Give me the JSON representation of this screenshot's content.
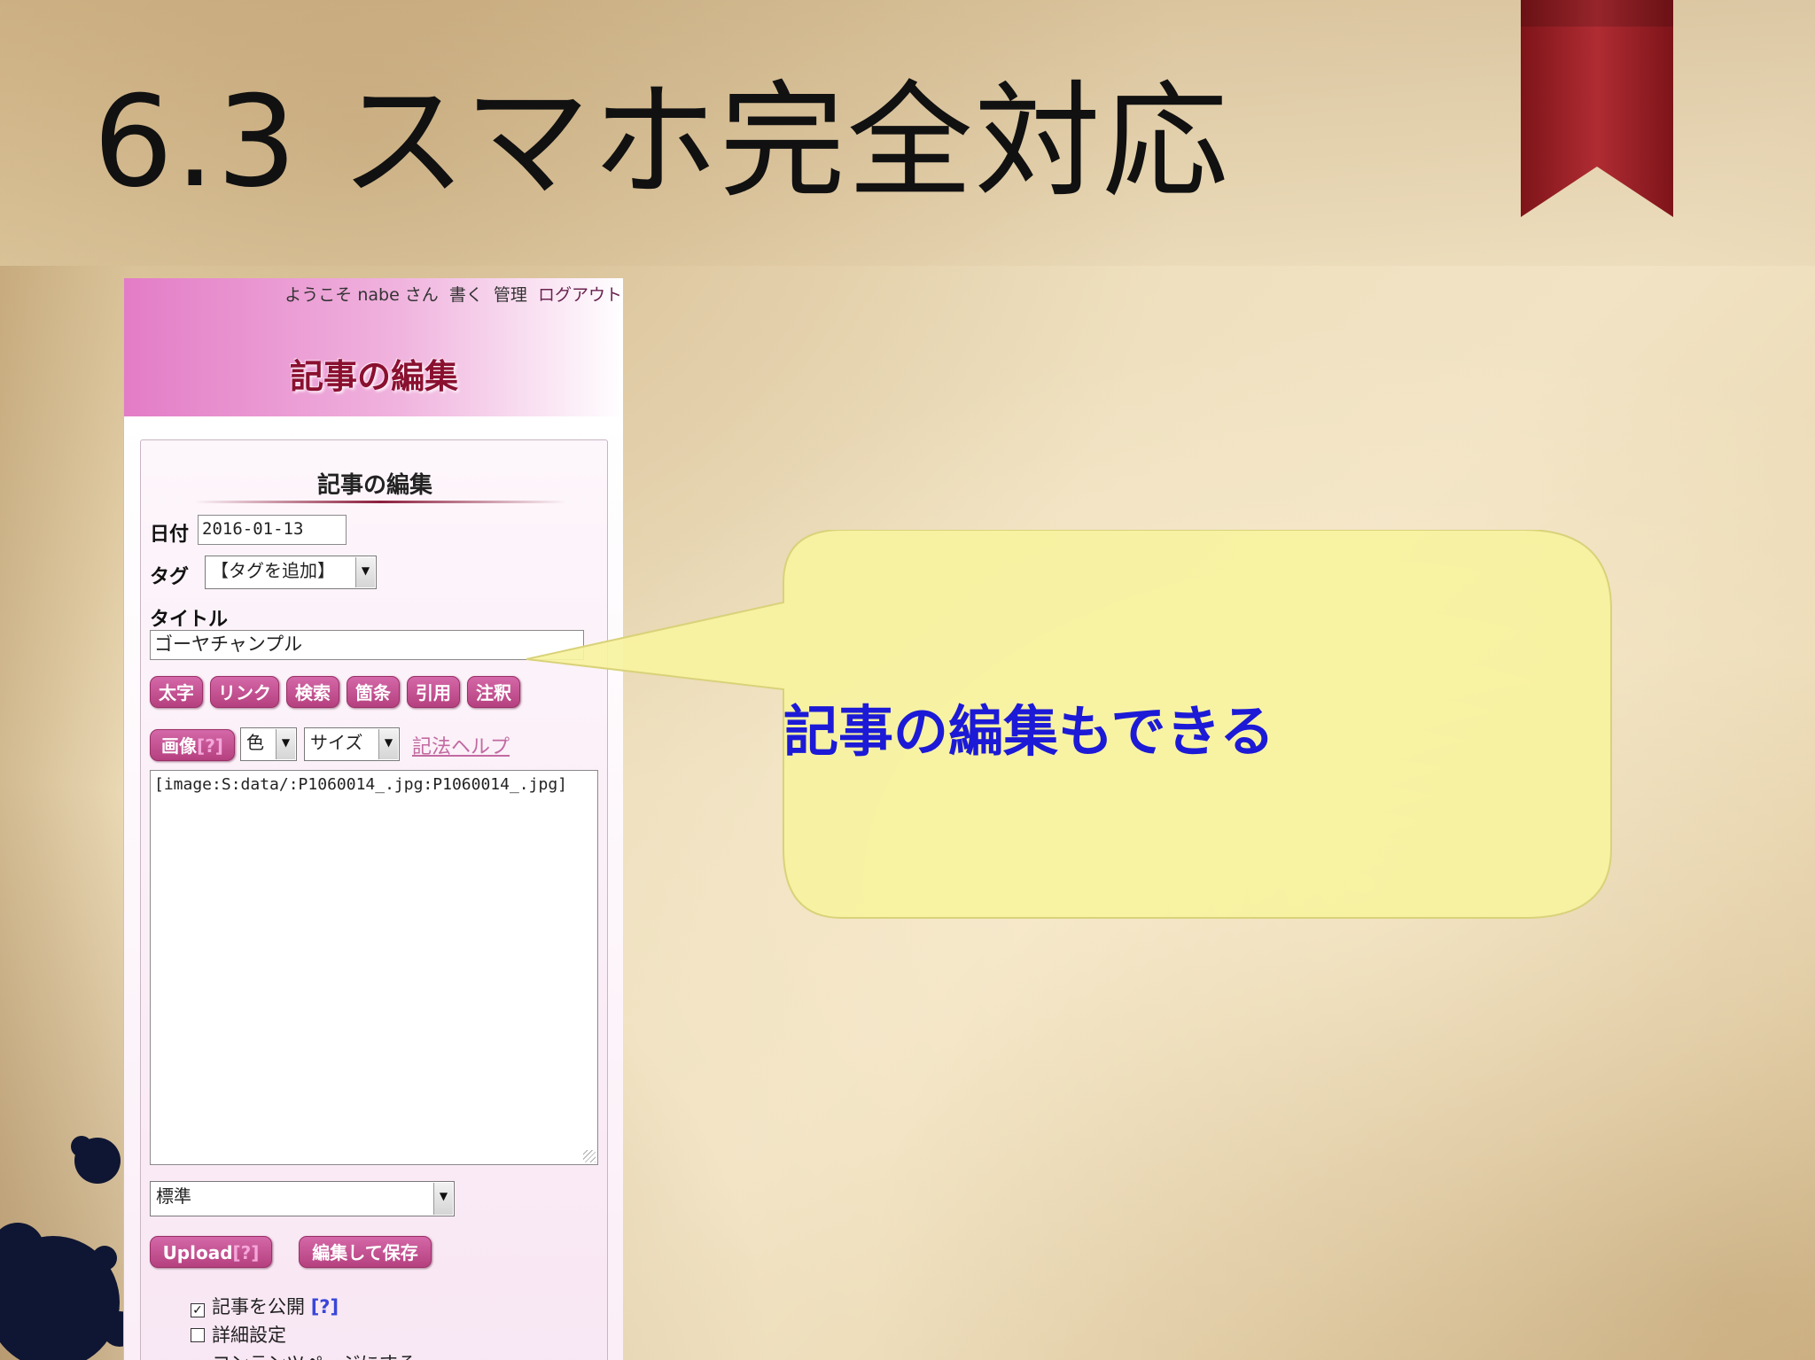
{
  "slide": {
    "title": "6.3 スマホ完全対応"
  },
  "phone": {
    "user_bar": {
      "welcome": "ようこそ nabe さん",
      "write": "書く",
      "admin": "管理",
      "logout": "ログアウト"
    },
    "blog_title": "記事の編集",
    "panel": {
      "title": "記事の編集",
      "date_label": "日付",
      "date_value": "2016-01-13",
      "tag_label": "タグ",
      "tag_selected": "【タグを追加】",
      "title_label": "タイトル",
      "title_value": "ゴーヤチャンプル",
      "format_buttons": [
        "太字",
        "リンク",
        "検索",
        "箇条",
        "引用",
        "注釈"
      ],
      "image_button": "画像",
      "help_mark": "[?]",
      "color_select": "色",
      "size_select": "サイズ",
      "syntax_help": "記法ヘルプ",
      "body_text": "[image:S:data/:P1060014_.jpg:P1060014_.jpg]",
      "mode_select": "標準",
      "upload_button": "Upload",
      "save_button": "編集して保存",
      "options": [
        {
          "label": "記事を公開",
          "checked": true,
          "help": "[?]"
        },
        {
          "label": "詳細設定",
          "checked": false,
          "help": ""
        },
        {
          "label": "コンテンツページにする",
          "checked": true,
          "help": ""
        }
      ]
    }
  },
  "callout": {
    "text": "記事の編集もできる",
    "fill_color": "#f7f3a0",
    "text_color": "#1c1ad6"
  },
  "colors": {
    "bookmark": "#9e2229",
    "button_pink": "#c24e90",
    "header_pink": "#e37cc6"
  }
}
